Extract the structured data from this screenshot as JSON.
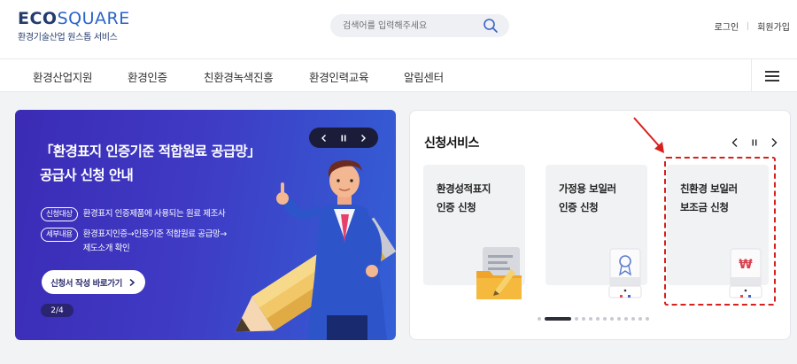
{
  "header": {
    "logo_eco": "ECO",
    "logo_square": "SQUARE",
    "logo_subtitle": "환경기술산업 원스톱 서비스",
    "search_placeholder": "검색어를 입력해주세요",
    "search_icon": "search-icon",
    "login": "로그인",
    "signup": "회원가입"
  },
  "nav": {
    "items": [
      "환경산업지원",
      "환경인증",
      "친환경녹색진흥",
      "환경인력교육",
      "알림센터"
    ],
    "menu_icon": "hamburger-icon"
  },
  "banner": {
    "title_line1": "「환경표지 인증기준 적합원료 공급망」",
    "title_line2": "공급사 신청 안내",
    "rows": [
      {
        "tag": "신청대상",
        "text": "환경표지 인증제품에 사용되는 원료 제조사"
      },
      {
        "tag": "세부내용",
        "text": "환경표지인증→인증기준 적합원료 공급망→",
        "text2": "제도소개 확인"
      }
    ],
    "button_label": "신청서 작성 바로가기",
    "page_indicator": "2/4",
    "colors": {
      "start": "#3b2bb5",
      "end": "#3360d6"
    }
  },
  "services": {
    "title": "신청서비스",
    "cards": [
      {
        "line1": "환경성적표지",
        "line2": "인증 신청",
        "icon": "document-pencil-icon"
      },
      {
        "line1": "가정용 보일러",
        "line2": "인증 신청",
        "icon": "boiler-certificate-icon"
      },
      {
        "line1": "친환경 보일러",
        "line2": "보조금 신청",
        "icon": "boiler-won-icon"
      }
    ],
    "dot_count": 13,
    "active_dot": 1,
    "highlight_color": "#d7201d"
  }
}
